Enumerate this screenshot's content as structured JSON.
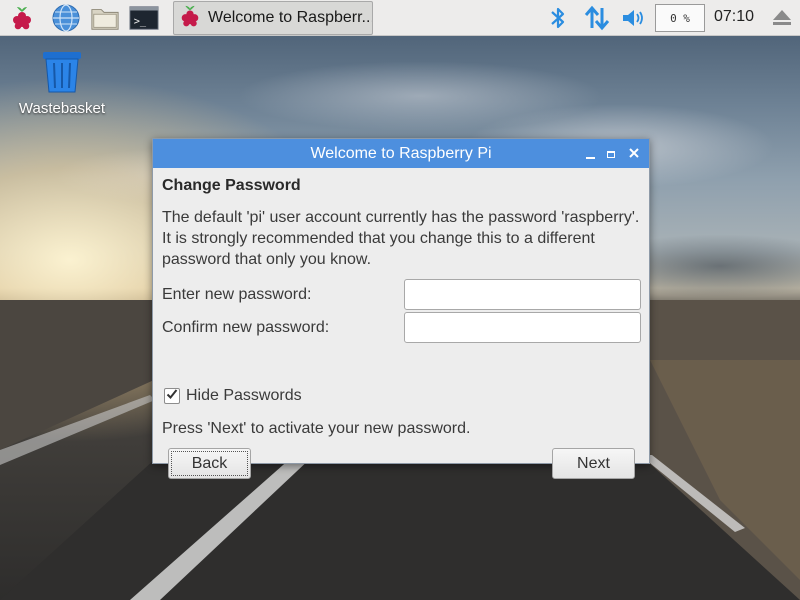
{
  "taskbar": {
    "launchers": [
      {
        "icon": "raspberry-menu-icon"
      },
      {
        "icon": "web-browser-icon"
      },
      {
        "icon": "file-manager-icon"
      },
      {
        "icon": "terminal-icon"
      }
    ],
    "task": {
      "label": "Welcome to Raspberr...",
      "icon": "raspberry-icon"
    },
    "tray": {
      "bluetooth": "bluetooth-icon",
      "network": "network-arrows-icon",
      "volume": "volume-icon",
      "cpu": "0 %",
      "clock": "07:10",
      "eject": "eject-icon"
    }
  },
  "desktop": {
    "icons": [
      {
        "label": "Wastebasket",
        "icon": "wastebasket-icon"
      }
    ]
  },
  "dialog": {
    "title": "Welcome to Raspberry Pi",
    "heading": "Change Password",
    "description": "The default 'pi' user account currently has the password 'raspberry'. It is strongly recommended that you change this to a different password that only you know.",
    "new_password_label": "Enter new password:",
    "new_password_value": "",
    "confirm_password_label": "Confirm new password:",
    "confirm_password_value": "",
    "hide_passwords_label": "Hide Passwords",
    "hide_passwords_checked": true,
    "hint": "Press 'Next' to activate your new password.",
    "back_label": "Back",
    "next_label": "Next"
  },
  "colors": {
    "titlebar": "#4d8fde",
    "dialog_bg": "#ededed",
    "taskbar_bg": "#edeceb",
    "tray_icon_blue": "#2b8de0"
  }
}
